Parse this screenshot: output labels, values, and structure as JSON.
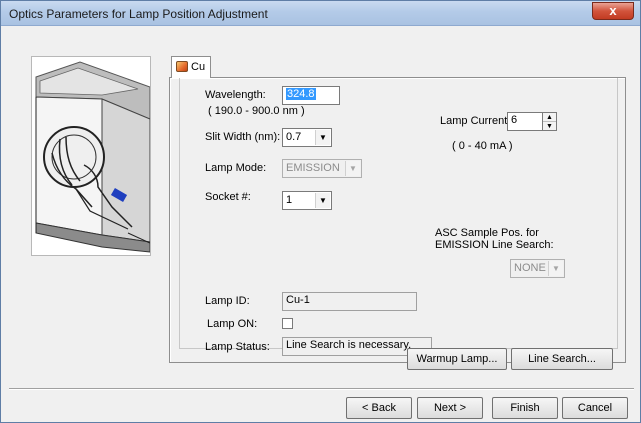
{
  "window": {
    "title": "Optics Parameters for Lamp Position Adjustment",
    "close_glyph": "x"
  },
  "tab": {
    "label": "Cu",
    "icon": "lamp-icon"
  },
  "form": {
    "wavelength_label": "Wavelength:",
    "wavelength_value": "324.8",
    "wavelength_range": "( 190.0 - 900.0 nm )",
    "slit_width_label": "Slit Width (nm):",
    "slit_width_value": "0.7",
    "lamp_mode_label": "Lamp Mode:",
    "lamp_mode_value": "EMISSION",
    "socket_label": "Socket #:",
    "socket_value": "1",
    "lamp_current_label": "Lamp Current:",
    "lamp_current_value": "6",
    "lamp_current_range": "( 0 - 40 mA )",
    "asc_label_line1": "ASC Sample Pos. for",
    "asc_label_line2": "EMISSION Line Search:",
    "asc_value": "NONE",
    "lamp_id_label": "Lamp ID:",
    "lamp_id_value": "Cu-1",
    "lamp_on_label": "Lamp ON:",
    "lamp_on_checked": false,
    "lamp_status_label": "Lamp Status:",
    "lamp_status_value": "Line Search is necessary."
  },
  "actions": {
    "warmup": "Warmup Lamp...",
    "line_search": "Line Search..."
  },
  "footer": {
    "back": "< Back",
    "next": "Next >",
    "finish": "Finish",
    "cancel": "Cancel"
  }
}
